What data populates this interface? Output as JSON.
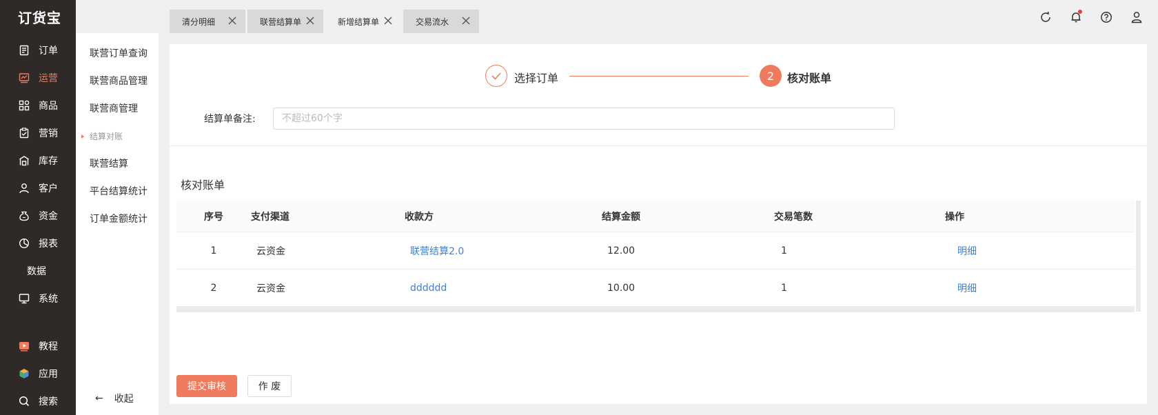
{
  "app": {
    "logo": "订货宝"
  },
  "leftnav": {
    "items": [
      {
        "label": "订单",
        "icon": "order-icon",
        "active": false
      },
      {
        "label": "运营",
        "icon": "operations-icon",
        "active": true
      },
      {
        "label": "商品",
        "icon": "goods-icon",
        "active": false
      },
      {
        "label": "营销",
        "icon": "marketing-icon",
        "active": false
      },
      {
        "label": "库存",
        "icon": "inventory-icon",
        "active": false
      },
      {
        "label": "客户",
        "icon": "customer-icon",
        "active": false
      },
      {
        "label": "资金",
        "icon": "funds-icon",
        "active": false
      },
      {
        "label": "报表",
        "icon": "report-icon",
        "active": false
      },
      {
        "label": "数据",
        "icon": "",
        "active": false
      },
      {
        "label": "系统",
        "icon": "system-icon",
        "active": false
      }
    ],
    "bottom": [
      {
        "label": "教程",
        "icon": "tutorial-icon"
      },
      {
        "label": "应用",
        "icon": "apps-icon"
      },
      {
        "label": "搜索",
        "icon": "search-icon"
      }
    ]
  },
  "submenu": {
    "items": [
      {
        "label": "联营订单查询",
        "type": "item"
      },
      {
        "label": "联营商品管理",
        "type": "item"
      },
      {
        "label": "联营商管理",
        "type": "item"
      },
      {
        "label": "结算对账",
        "type": "group"
      },
      {
        "label": "联营结算",
        "type": "item"
      },
      {
        "label": "平台结算统计",
        "type": "item"
      },
      {
        "label": "订单金额统计",
        "type": "item"
      }
    ],
    "collapse_arrow": "←",
    "collapse_label": "收起"
  },
  "tabs": [
    {
      "label": "清分明细",
      "active": false
    },
    {
      "label": "联营结算单",
      "active": false
    },
    {
      "label": "新增结算单",
      "active": true
    },
    {
      "label": "交易流水",
      "active": false
    }
  ],
  "steps": {
    "step1_label": "选择订单",
    "step2_number": "2",
    "step2_label": "核对账单"
  },
  "form": {
    "remark_label": "结算单备注:",
    "remark_placeholder": "不超过60个字",
    "remark_value": ""
  },
  "section_title": "核对账单",
  "table": {
    "headers": [
      "序号",
      "支付渠道",
      "收款方",
      "结算金额",
      "交易笔数",
      "操作"
    ],
    "rows": [
      {
        "index": "1",
        "channel": "云资金",
        "payee": "联营结算2.0",
        "amount": "12.00",
        "count": "1",
        "action": "明细"
      },
      {
        "index": "2",
        "channel": "云资金",
        "payee": "dddddd",
        "amount": "10.00",
        "count": "1",
        "action": "明细"
      }
    ]
  },
  "buttons": {
    "submit": "提交审核",
    "void": "作 废"
  },
  "colors": {
    "accent": "#f07a5d",
    "link": "#3f7fd4",
    "nav_bg": "#2f2a28",
    "notification_dot": "#e64040"
  }
}
